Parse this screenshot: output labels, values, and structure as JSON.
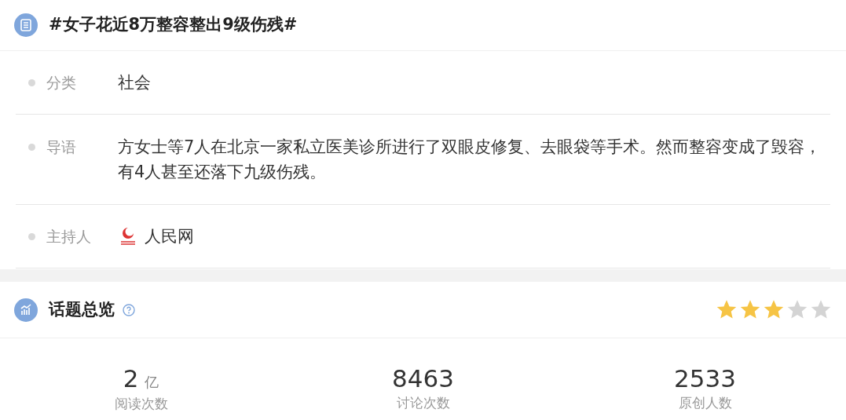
{
  "topic": {
    "title": "#女子花近8万整容整出9级伤残#"
  },
  "details": [
    {
      "kind": "text",
      "label": "分类",
      "value": "社会"
    },
    {
      "kind": "text",
      "label": "导语",
      "value": "方女士等7人在北京一家私立医美诊所进行了双眼皮修复、去眼袋等手术。然而整容变成了毁容，有4人甚至还落下九级伤残。"
    },
    {
      "kind": "host",
      "label": "主持人",
      "value": "人民网"
    }
  ],
  "overview": {
    "title": "话题总览",
    "stars": 3,
    "stats": [
      {
        "value": "2",
        "unit": "亿",
        "label": "阅读次数"
      },
      {
        "value": "8463",
        "label": "讨论次数"
      },
      {
        "value": "2533",
        "label": "原创人数"
      }
    ]
  }
}
